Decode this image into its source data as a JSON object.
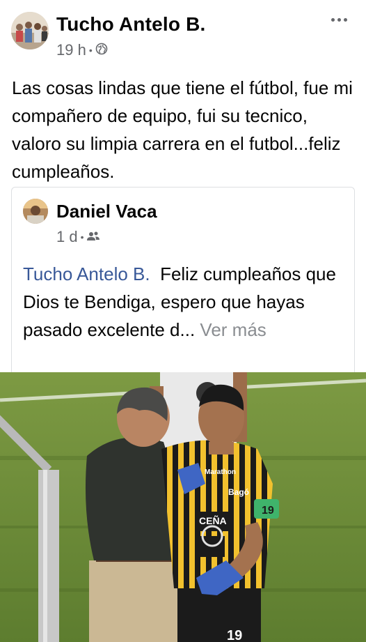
{
  "post": {
    "author": "Tucho Antelo B.",
    "time": "19 h",
    "visibility_icon": "globe-icon",
    "more_icon": "more-horizontal-icon",
    "text": "Las cosas lindas que tiene el fútbol, fue mi compañero de equipo, fui su tecnico, valoro su limpia carrera en el futbol...feliz cumpleaños."
  },
  "shared_post": {
    "author": "Daniel Vaca",
    "time": "1 d",
    "visibility_icon": "friends-icon",
    "mention": "Tucho Antelo B.",
    "text": "Feliz cumpleaños que Dios te Bendiga, espero que hayas pasado  excelente d...",
    "see_more": "Ver más"
  },
  "photo": {
    "jersey_sponsor_1": "Marathon",
    "jersey_sponsor_2": "Bagó",
    "jersey_sponsor_3": "CEÑA",
    "armband_number": "19",
    "shorts_number": "19",
    "colors": {
      "grass": "#6f8f3a",
      "jersey_yellow": "#f2c12e",
      "jersey_black": "#1b1b1b",
      "coach_shirt": "#2f332e",
      "coach_pants": "#cbb894",
      "glove_blue": "#3f66c4",
      "armband_green": "#3fb36b"
    }
  }
}
